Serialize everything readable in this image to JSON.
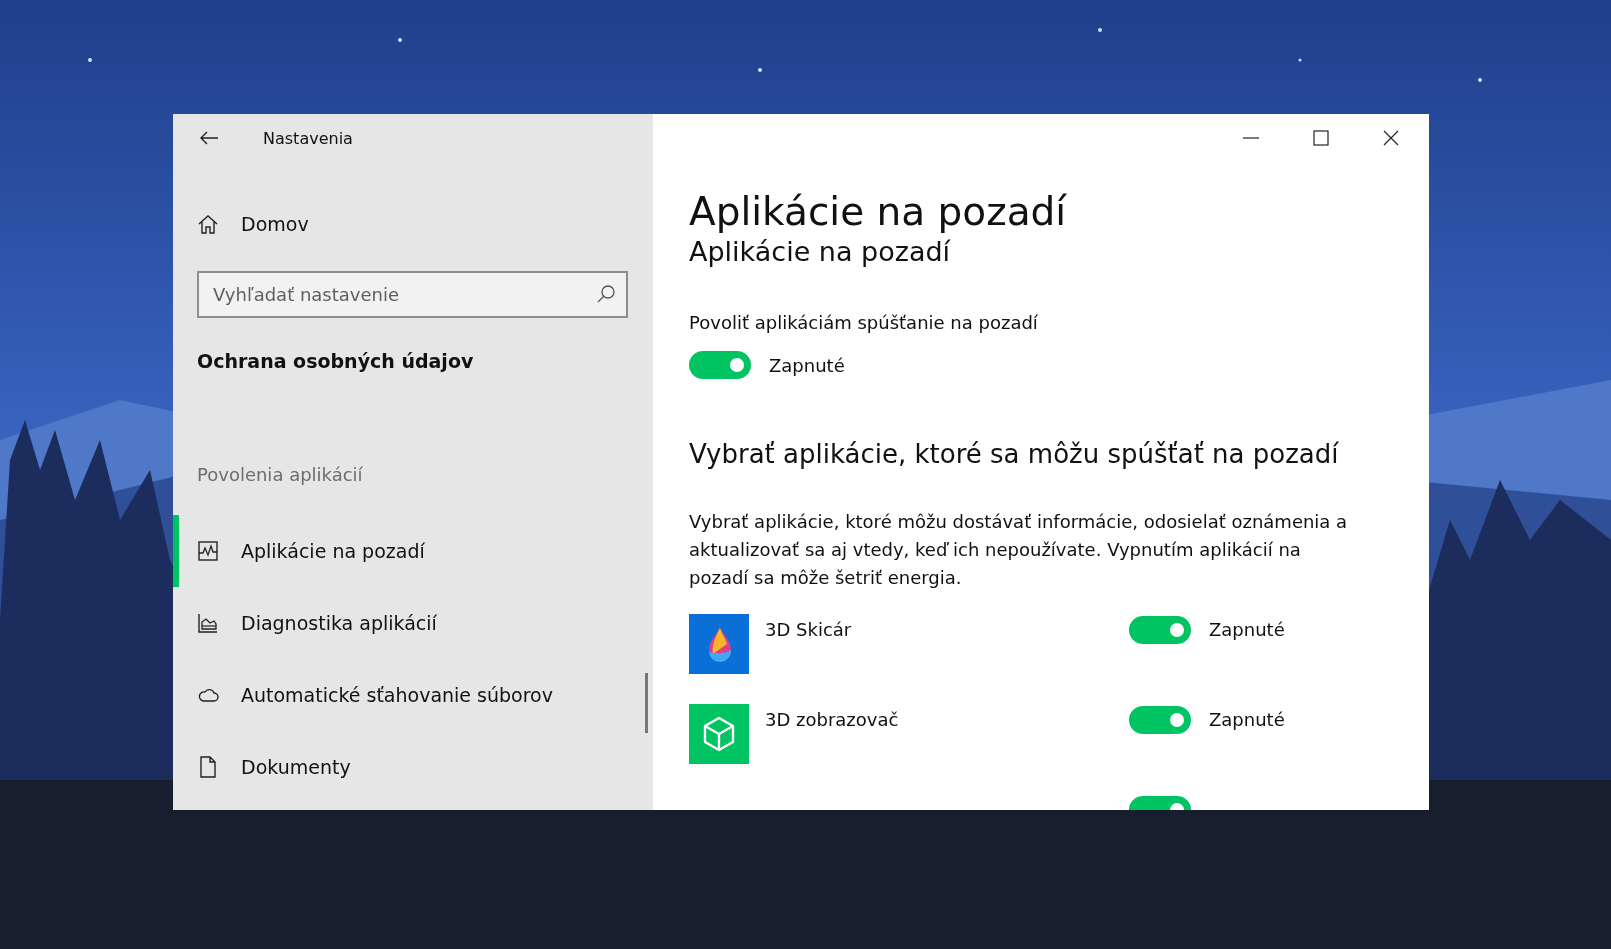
{
  "window": {
    "title": "Nastavenia"
  },
  "sidebar": {
    "home": "Domov",
    "search": {
      "placeholder": "Vyhľadať nastavenie"
    },
    "category": "Ochrana osobných údajov",
    "section": "Povolenia aplikácií",
    "items": [
      {
        "label": "Aplikácie na pozadí",
        "kind": "activity",
        "selected": true
      },
      {
        "label": "Diagnostika aplikácií",
        "kind": "chart",
        "selected": false
      },
      {
        "label": "Automatické sťahovanie súborov",
        "kind": "cloud",
        "selected": false
      },
      {
        "label": "Dokumenty",
        "kind": "document",
        "selected": false
      }
    ]
  },
  "page": {
    "title": "Aplikácie na pozadí",
    "scrolled_heading": "Aplikácie na pozadí",
    "master": {
      "label": "Povoliť aplikáciám spúšťanie na pozadí",
      "on": true,
      "state": "Zapnuté"
    },
    "apps_heading": "Vybrať aplikácie, ktoré sa môžu spúšťať na pozadí",
    "description": "Vybrať aplikácie, ktoré môžu dostávať informácie, odosielať oznámenia a aktualizovať sa aj vtedy, keď ich nepoužívate. Vypnutím aplikácií na pozadí sa môže šetriť energia.",
    "apps": [
      {
        "name": "3D Skicár",
        "kind": "paint",
        "on": true,
        "state": "Zapnuté"
      },
      {
        "name": "3D zobrazovač",
        "kind": "viewer",
        "on": true,
        "state": "Zapnuté"
      },
      {
        "on": true
      }
    ]
  }
}
